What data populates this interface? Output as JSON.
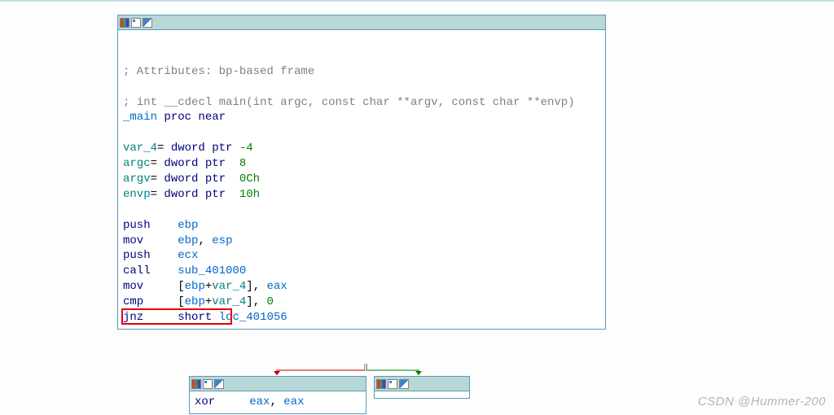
{
  "top_node": {
    "comment1": "; Attributes: bp-based frame",
    "comment2_prefix": "; ",
    "sig_type": "int",
    "sig_cc": "__cdecl",
    "sig_name": "main",
    "sig_p1t": "int",
    "sig_p1n": "argc",
    "sig_p2q": "const char",
    "sig_p2n": "**argv",
    "sig_p3q": "const char",
    "sig_p3n": "**envp",
    "proc_label": "_main",
    "proc_kw": "proc near",
    "v1_name": "var_4",
    "v1_eq": "=",
    "v1_type": "dword ptr",
    "v1_off": "-4",
    "v2_name": "argc",
    "v2_eq": "=",
    "v2_type": "dword ptr",
    "v2_off": " 8",
    "v3_name": "argv",
    "v3_eq": "=",
    "v3_type": "dword ptr",
    "v3_off": " 0Ch",
    "v4_name": "envp",
    "v4_eq": "=",
    "v4_type": "dword ptr",
    "v4_off": " 10h",
    "i1_op": "push",
    "i1_a1": "ebp",
    "i2_op": "mov",
    "i2_a1": "ebp",
    "i2_c": ", ",
    "i2_a2": "esp",
    "i3_op": "push",
    "i3_a1": "ecx",
    "i4_op": "call",
    "i4_a1": "sub_401000",
    "i5_op": "mov",
    "i5_b1": "[",
    "i5_r": "ebp",
    "i5_p": "+",
    "i5_v": "var_4",
    "i5_b2": "]",
    "i5_c": ", ",
    "i5_a2": "eax",
    "i6_op": "cmp",
    "i6_b1": "[",
    "i6_r": "ebp",
    "i6_p": "+",
    "i6_v": "var_4",
    "i6_b2": "]",
    "i6_c": ", ",
    "i6_a2": "0",
    "i7_op": "jnz",
    "i7_kw": "short",
    "i7_t": "loc_401056"
  },
  "left_child": {
    "i1_op": "xor",
    "i1_a1": "eax",
    "i1_c": ", ",
    "i1_a2": "eax"
  },
  "right_child": {
    "partial": ""
  },
  "watermark": "CSDN @Hummer-200"
}
